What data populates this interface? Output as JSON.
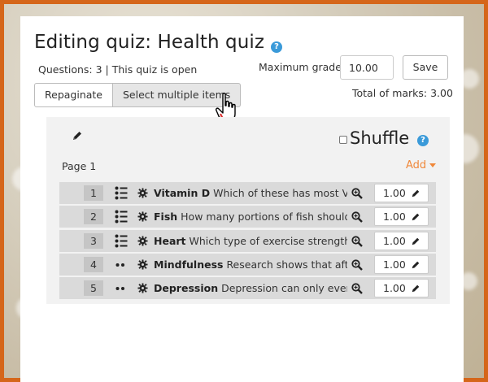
{
  "page": {
    "title": "Editing quiz: Health quiz",
    "status": "Questions: 3 | This quiz is open",
    "grade_label": "Maximum grade",
    "grade_value": "10.00",
    "save_label": "Save",
    "total_marks": "Total of marks: 3.00",
    "repaginate_label": "Repaginate",
    "select_multiple_label": "Select multiple items",
    "shuffle_label": "Shuffle",
    "page_label": "Page 1",
    "add_label": "Add"
  },
  "questions": [
    {
      "num": "1",
      "type": "multichoice-icon",
      "name": "Vitamin D",
      "text": "Which of these has most Vita",
      "mark": "1.00"
    },
    {
      "num": "2",
      "type": "multichoice-icon",
      "name": "Fish",
      "text": "How many portions of fish should y",
      "mark": "1.00"
    },
    {
      "num": "3",
      "type": "multichoice-icon",
      "name": "Heart",
      "text": "Which type of exercise strengthe",
      "mark": "1.00"
    },
    {
      "num": "4",
      "type": "dots-icon",
      "name": "Mindfulness",
      "text": "Research shows that after",
      "mark": "1.00"
    },
    {
      "num": "5",
      "type": "dots-icon",
      "name": "Depression",
      "text": "Depression can only ever tr",
      "mark": "1.00"
    }
  ],
  "colors": {
    "accent": "#f0883a",
    "help": "#3a9ad9",
    "frame": "#d5661a",
    "slot_bg": "#dadada",
    "section_bg": "#f2f2f2"
  }
}
